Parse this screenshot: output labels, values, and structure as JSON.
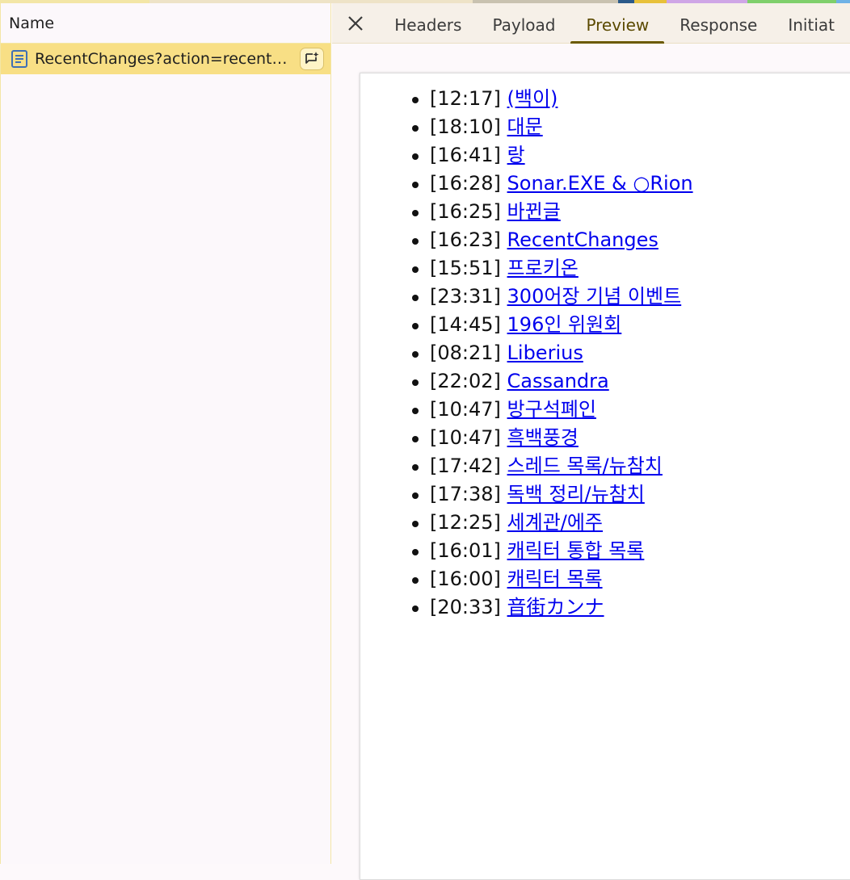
{
  "left_panel": {
    "header": "Name",
    "request": {
      "name": "RecentChanges?action=recent…",
      "icon": "document-icon"
    }
  },
  "tabs": {
    "close_icon": "close-icon",
    "items": [
      {
        "label": "Headers",
        "active": false
      },
      {
        "label": "Payload",
        "active": false
      },
      {
        "label": "Preview",
        "active": true
      },
      {
        "label": "Response",
        "active": false
      },
      {
        "label": "Initiat",
        "active": false
      }
    ]
  },
  "preview": {
    "items": [
      {
        "time": "[12:17]",
        "title": "(백이)"
      },
      {
        "time": "[18:10]",
        "title": "대문"
      },
      {
        "time": "[16:41]",
        "title": "랑"
      },
      {
        "time": "[16:28]",
        "title": "Sonar.EXE & ○Rion"
      },
      {
        "time": "[16:25]",
        "title": "바뀐글"
      },
      {
        "time": "[16:23]",
        "title": "RecentChanges"
      },
      {
        "time": "[15:51]",
        "title": "프로키온"
      },
      {
        "time": "[23:31]",
        "title": "300어장 기념 이벤트"
      },
      {
        "time": "[14:45]",
        "title": "196인 위원회"
      },
      {
        "time": "[08:21]",
        "title": "Liberius"
      },
      {
        "time": "[22:02]",
        "title": "Cassandra"
      },
      {
        "time": "[10:47]",
        "title": "방구석폐인"
      },
      {
        "time": "[10:47]",
        "title": "흑백풍경"
      },
      {
        "time": "[17:42]",
        "title": "스레드 목록/뉴참치"
      },
      {
        "time": "[17:38]",
        "title": "독백 정리/뉴참치"
      },
      {
        "time": "[12:25]",
        "title": "세계관/에주"
      },
      {
        "time": "[16:01]",
        "title": "캐릭터 통합 목록"
      },
      {
        "time": "[16:00]",
        "title": "캐릭터 목록"
      },
      {
        "time": "[20:33]",
        "title": "音街カンナ"
      }
    ]
  },
  "colors": {
    "selected_row": "#f8df85",
    "active_tab": "#5b4a00",
    "link": "#0000ee"
  }
}
